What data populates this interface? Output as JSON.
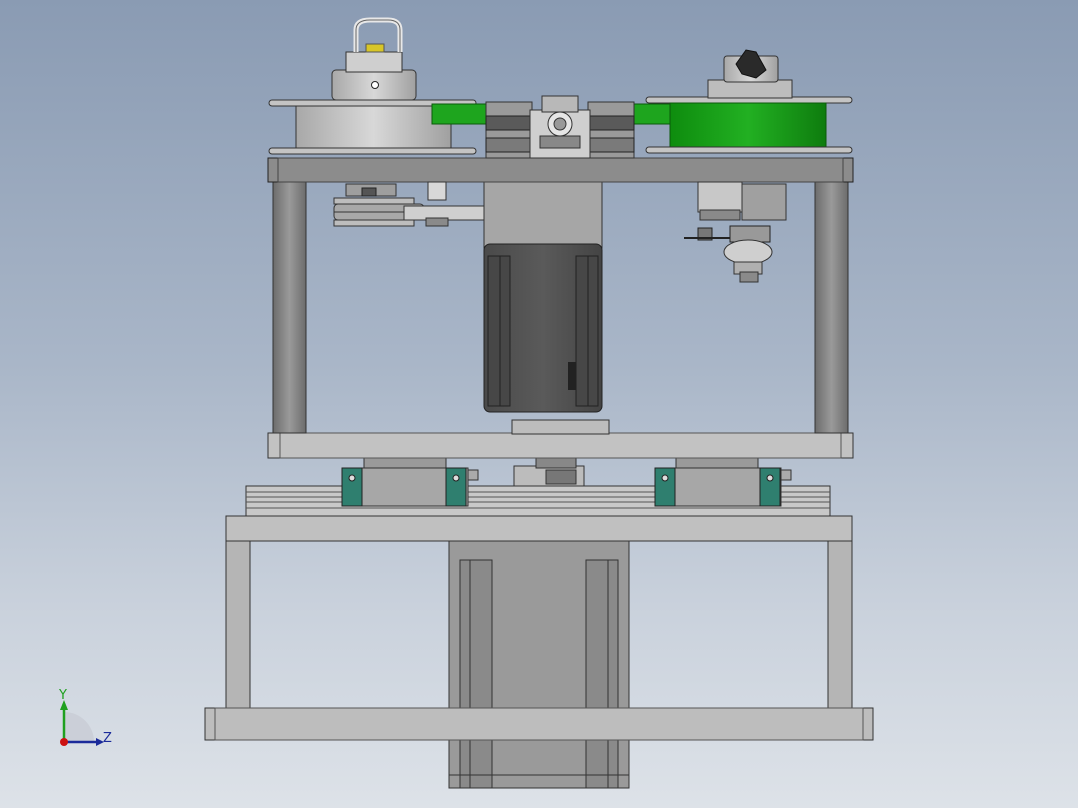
{
  "view": {
    "background_top": "#8a9bb3",
    "background_bottom": "#dde2e8"
  },
  "triad": {
    "y_label": "Y",
    "z_label": "Z",
    "y_color": "#1fa01f",
    "z_color": "#1a2a9a",
    "x_color": "#cc1111"
  },
  "colors": {
    "frame_steel": "#8c8c8c",
    "plate_light": "#b8b8b8",
    "motor_dark": "#505050",
    "green_part": "#1ea51e",
    "rail_teal": "#2f7f6f"
  }
}
